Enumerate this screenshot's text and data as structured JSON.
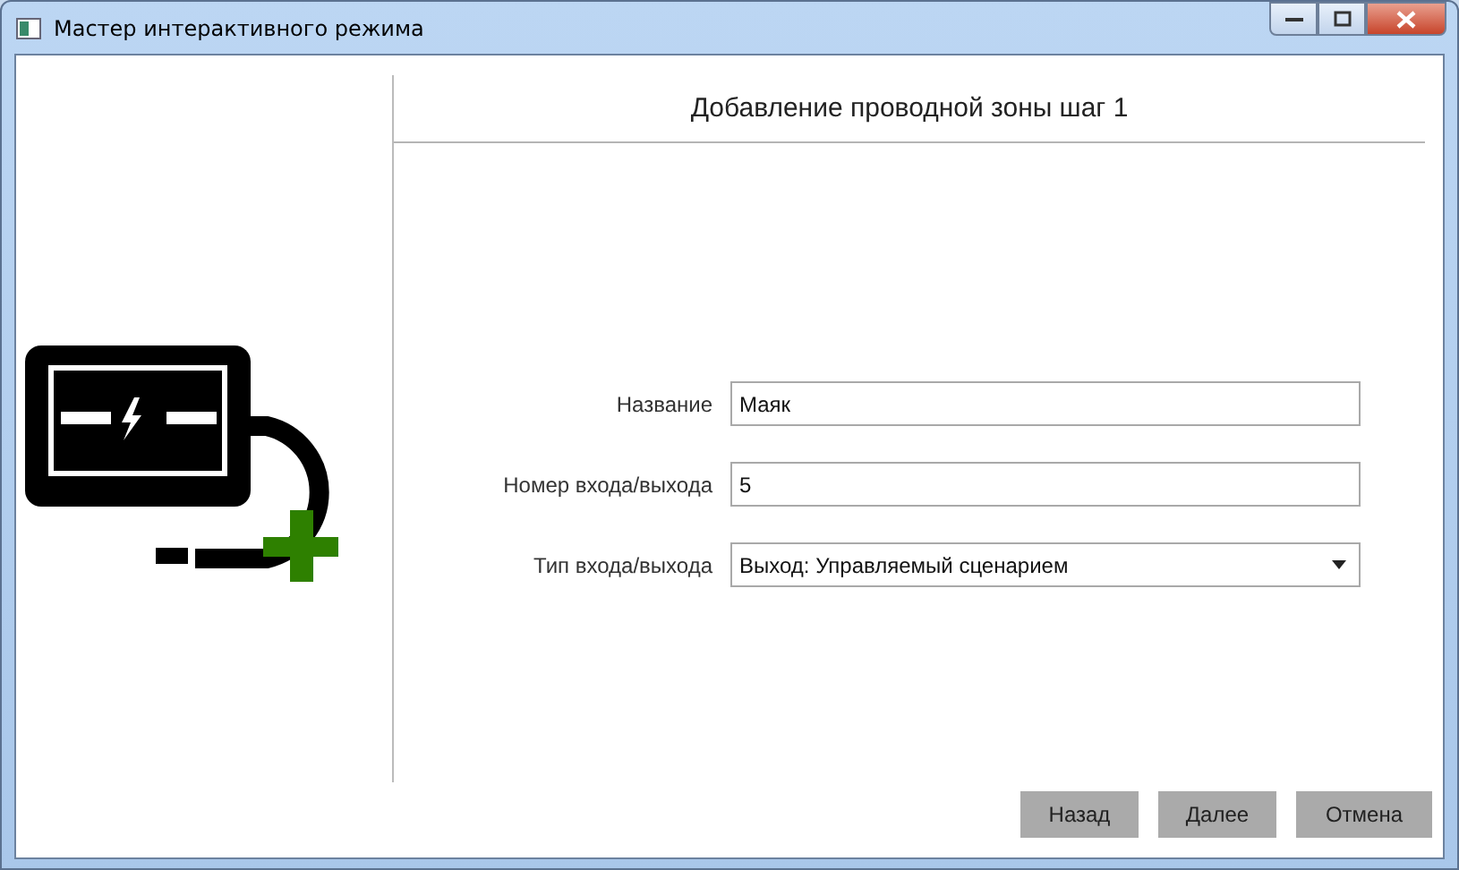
{
  "window": {
    "title": "Мастер интерактивного режима"
  },
  "heading": "Добавление проводной зоны шаг 1",
  "fields": [
    {
      "label": "Название",
      "value": "Маяк",
      "kind": "text"
    },
    {
      "label": "Номер входа/выхода",
      "value": "5",
      "kind": "text"
    },
    {
      "label": "Тип входа/выхода",
      "value": "Выход: Управляемый сценарием",
      "kind": "select"
    }
  ],
  "buttons": [
    "Назад",
    "Далее",
    "Отмена"
  ]
}
